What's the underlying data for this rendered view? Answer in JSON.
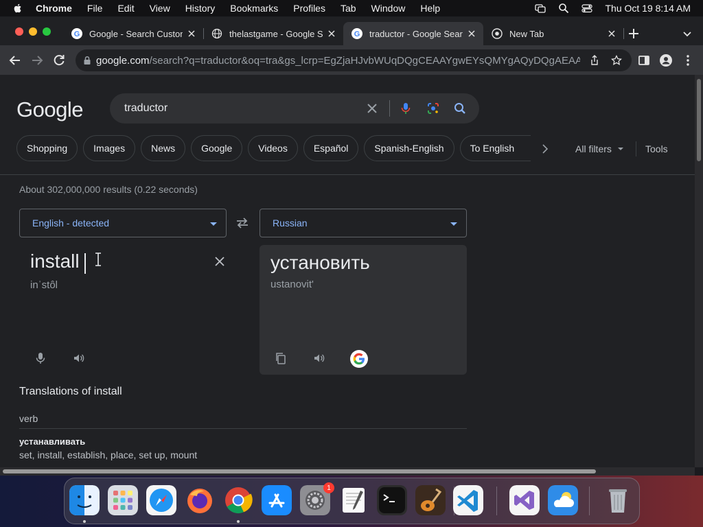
{
  "menubar": {
    "app": "Chrome",
    "items": [
      "File",
      "Edit",
      "View",
      "History",
      "Bookmarks",
      "Profiles",
      "Tab",
      "Window",
      "Help"
    ],
    "clock": "Thu Oct 19  8:14 AM"
  },
  "tabs": [
    {
      "title": "Google - Search Custom",
      "icon": "google-favicon",
      "active": false
    },
    {
      "title": "thelastgame - Google S",
      "icon": "globe-favicon",
      "active": false
    },
    {
      "title": "traductor - Google Sear",
      "icon": "google-favicon",
      "active": true
    },
    {
      "title": "New Tab",
      "icon": "chrome-favicon",
      "active": false
    }
  ],
  "omnibox": {
    "domain": "google.com",
    "path": "/search?q=traductor&oq=tra&gs_lcrp=EgZjaHJvbWUqDQgCEAAYgwEYsQMYgAQyDQgAEAAY..."
  },
  "search": {
    "logo": "Google",
    "query": "traductor"
  },
  "chips": [
    "Shopping",
    "Images",
    "News",
    "Google",
    "Videos",
    "Español",
    "Spanish-English",
    "To English"
  ],
  "filters": {
    "all_filters": "All filters",
    "tools": "Tools"
  },
  "stats": "About 302,000,000 results (0.22 seconds)",
  "translator": {
    "source_lang": "English - detected",
    "target_lang": "Russian",
    "source_text": "install",
    "source_phonetic": "inˈstôl",
    "target_text": "установить",
    "target_translit": "ustanovit'"
  },
  "translations": {
    "heading": "Translations of install",
    "pos": "verb",
    "word": "устанавливать",
    "synonyms": "set, install, establish, place, set up, mount"
  },
  "dock": {
    "apps": [
      "Finder",
      "Launchpad",
      "Safari",
      "Firefox",
      "Chrome",
      "App Store",
      "System Settings",
      "TextEdit",
      "Terminal",
      "GarageBand",
      "Visual Studio Code",
      "Visual Studio",
      "Weather",
      "Trash"
    ],
    "settings_badge": "1"
  },
  "colors": {
    "accent": "#8ab4f8",
    "page_bg": "#202124",
    "chrome_bg": "#35363a"
  }
}
